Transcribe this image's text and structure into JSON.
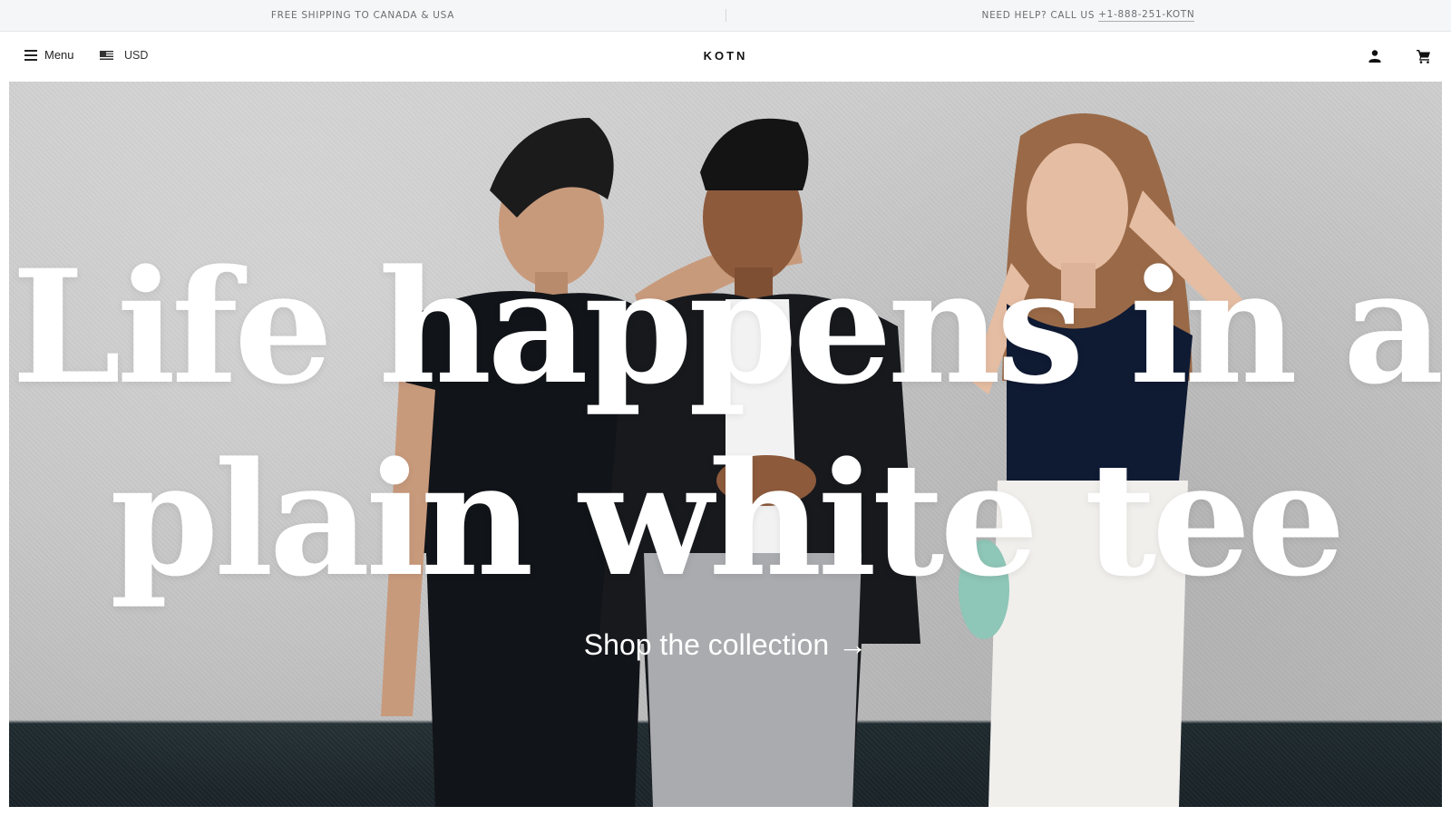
{
  "announcement": {
    "shipping": "FREE SHIPPING TO CANADA & USA",
    "help_prefix": "NEED HELP? CALL US",
    "phone": "+1-888-251-KOTN"
  },
  "nav": {
    "menu_label": "Menu",
    "currency_label": "USD",
    "logo": "KOTN",
    "icons": [
      "menu-icon",
      "us-flag-icon",
      "account-icon",
      "cart-icon"
    ]
  },
  "hero": {
    "headline_line1": "Life happens in a",
    "headline_line2": "plain white tee",
    "cta_label": "Shop the collection",
    "cta_arrow": "→",
    "colors": {
      "wall": "#c8c8c8",
      "floor": "#1c262b",
      "headline": "#ffffff"
    }
  }
}
